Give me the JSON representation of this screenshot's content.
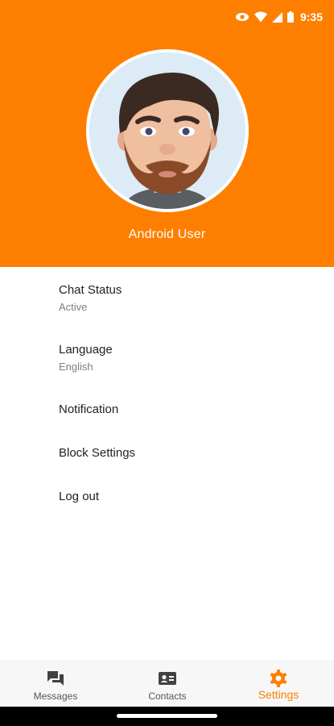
{
  "status_bar": {
    "time": "9:35",
    "icons": [
      "eye-icon",
      "wifi-icon",
      "signal-icon",
      "battery-icon"
    ]
  },
  "profile": {
    "name": "Android User",
    "avatar": "memoji-avatar"
  },
  "settings": [
    {
      "title": "Chat Status",
      "subtitle": "Active"
    },
    {
      "title": "Language",
      "subtitle": "English"
    },
    {
      "title": "Notification"
    },
    {
      "title": "Block Settings"
    },
    {
      "title": "Log out"
    }
  ],
  "bottom_nav": {
    "items": [
      {
        "label": "Messages",
        "icon": "messages-icon"
      },
      {
        "label": "Contacts",
        "icon": "contacts-icon"
      },
      {
        "label": "Settings",
        "icon": "gear-icon",
        "active": true
      }
    ]
  },
  "colors": {
    "accent": "#fe7f00",
    "text": "#222222",
    "subtext": "#808080"
  }
}
